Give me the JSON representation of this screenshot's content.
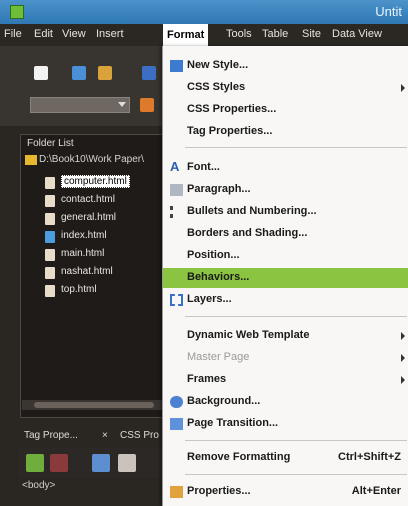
{
  "title": "Untit",
  "menubar": [
    "File",
    "Edit",
    "View",
    "Insert",
    "Format",
    "Tools",
    "Table",
    "Site",
    "Data View"
  ],
  "active_menu": "Format",
  "folder_list": {
    "title": "Folder List",
    "path": "D:\\Book10\\Work Paper\\",
    "files": [
      {
        "name": "computer.html",
        "icon": "page-icon",
        "selected": true
      },
      {
        "name": "contact.html",
        "icon": "page-icon"
      },
      {
        "name": "general.html",
        "icon": "page-icon"
      },
      {
        "name": "index.html",
        "icon": "home-page-icon"
      },
      {
        "name": "main.html",
        "icon": "page-icon"
      },
      {
        "name": "nashat.html",
        "icon": "page-icon"
      },
      {
        "name": "top.html",
        "icon": "page-icon"
      }
    ]
  },
  "bottom_tabs": [
    "Tag Prope...",
    "CSS Pro"
  ],
  "status": "<body>",
  "format_menu": [
    {
      "label": "New Style...",
      "icon": "new-style-icon"
    },
    {
      "label": "CSS Styles",
      "submenu": true
    },
    {
      "label": "CSS Properties..."
    },
    {
      "label": "Tag Properties..."
    },
    {
      "sep": true
    },
    {
      "label": "Font...",
      "icon": "font-icon"
    },
    {
      "label": "Paragraph...",
      "icon": "paragraph-icon"
    },
    {
      "label": "Bullets and Numbering...",
      "icon": "bullets-icon"
    },
    {
      "label": "Borders and Shading..."
    },
    {
      "label": "Position..."
    },
    {
      "label": "Behaviors...",
      "highlight": true
    },
    {
      "label": "Layers...",
      "icon": "layers-icon"
    },
    {
      "sep": true
    },
    {
      "label": "Dynamic Web Template",
      "submenu": true
    },
    {
      "label": "Master Page",
      "submenu": true,
      "disabled": true
    },
    {
      "label": "Frames",
      "submenu": true
    },
    {
      "label": "Background...",
      "icon": "background-icon"
    },
    {
      "label": "Page Transition...",
      "icon": "page-transition-icon"
    },
    {
      "sep": true
    },
    {
      "label": "Remove Formatting",
      "shortcut": "Ctrl+Shift+Z"
    },
    {
      "sep": true
    },
    {
      "label": "Properties...",
      "icon": "properties-icon",
      "shortcut": "Alt+Enter"
    }
  ],
  "colors": {
    "highlight": "#8bc441",
    "titlebar": "#3a86c2",
    "panel": "#1e1b19"
  }
}
